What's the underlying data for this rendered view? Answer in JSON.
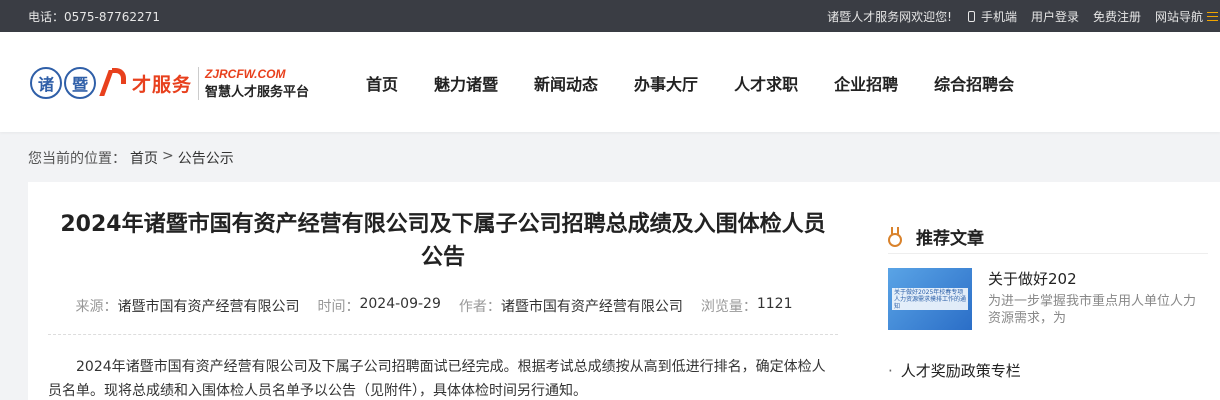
{
  "topbar": {
    "phone": "电话：0575-87762271",
    "welcome": "诸暨人才服务网欢迎您!",
    "mobile": "手机端",
    "login": "用户登录",
    "register": "免费注册",
    "sitenav": "网站导航"
  },
  "logo": {
    "seal_chars": [
      "诸",
      "暨"
    ],
    "cf": "才服务",
    "domain": "ZJRCFW.COM",
    "platform": "智慧人才服务平台"
  },
  "nav": [
    "首页",
    "魅力诸暨",
    "新闻动态",
    "办事大厅",
    "人才求职",
    "企业招聘",
    "综合招聘会"
  ],
  "breadcrumb": {
    "prefix": "您当前的位置：",
    "home": "首页",
    "sep": ">",
    "current": "公告公示"
  },
  "article": {
    "title": "2024年诸暨市国有资产经营有限公司及下属子公司招聘总成绩及入围体检人员公告",
    "source_label": "来源：",
    "source": "诸暨市国有资产经营有限公司",
    "time_label": "时间：",
    "time": "2024-09-29",
    "author_label": "作者：",
    "author": "诸暨市国有资产经营有限公司",
    "views_label": "浏览量：",
    "views": "1121",
    "body": "2024年诸暨市国有资产经营有限公司及下属子公司招聘面试已经完成。根据考试总成绩按从高到低进行排名，确定体检人员名单。现将总成绩和入围体检人员名单予以公告（见附件），具体体检时间另行通知。"
  },
  "sidebar": {
    "heading": "推荐文章",
    "recommended": {
      "thumb_text": "关于做好2025年校春专项人力资源需求摸排工作的通知",
      "title": "关于做好202",
      "desc": "为进一步掌握我市重点用人单位人力资源需求，为"
    },
    "column": "人才奖励政策专栏"
  },
  "colors": {
    "topbar_bg": "#3a3d44",
    "brand_red": "#e8401d",
    "brand_blue": "#2f5fa8",
    "accent_gold": "#f0a400"
  }
}
